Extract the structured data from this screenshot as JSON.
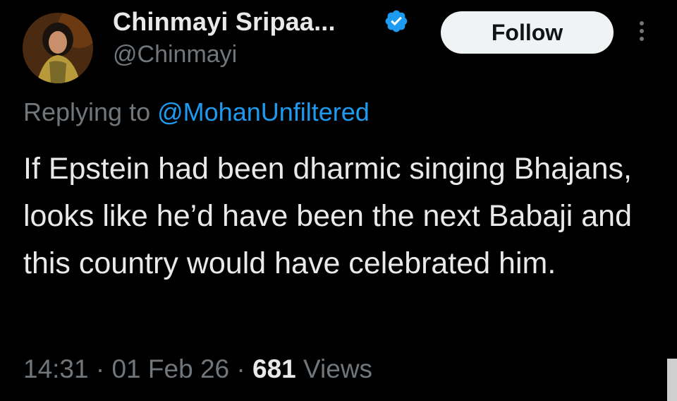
{
  "author": {
    "display_name": "Chinmayi Sripaa...",
    "handle": "@Chinmayi",
    "verified": true
  },
  "follow_button": {
    "label": "Follow"
  },
  "reply": {
    "prefix": "Replying to",
    "mention": "@MohanUnfiltered"
  },
  "tweet": {
    "text": "If Epstein had been dharmic singing Bhajans, looks like he’d have been the next Babaji and this country would have celebrated him."
  },
  "meta": {
    "time": "14:31",
    "separator": "·",
    "date": "01 Feb 26",
    "views_count": "681",
    "views_label": "Views"
  },
  "icons": {
    "verified": "verified-badge-icon",
    "more": "more-options-icon"
  },
  "colors": {
    "background": "#000000",
    "text_primary": "#e7e9ea",
    "text_secondary": "#71767b",
    "link": "#1d9bf0",
    "verified": "#1d9bf0",
    "follow_bg": "#eff3f4",
    "follow_text": "#0f1419"
  }
}
